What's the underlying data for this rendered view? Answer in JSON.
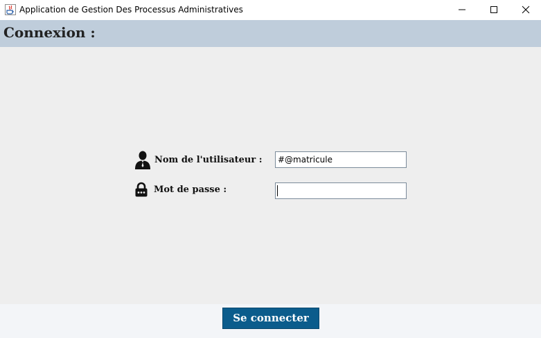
{
  "window": {
    "title": "Application de Gestion Des Processus Administratives"
  },
  "header": {
    "title": "Connexion :"
  },
  "form": {
    "username_label": "Nom de l'utilisateur :",
    "username_value": "#@matricule",
    "password_label": "Mot de passe :",
    "password_value": ""
  },
  "footer": {
    "connect_label": "Se connecter"
  },
  "colors": {
    "header_background": "#bfcddb",
    "content_background": "#eeeeee",
    "button_background": "#0b5c8c",
    "button_text": "#ffffff"
  }
}
